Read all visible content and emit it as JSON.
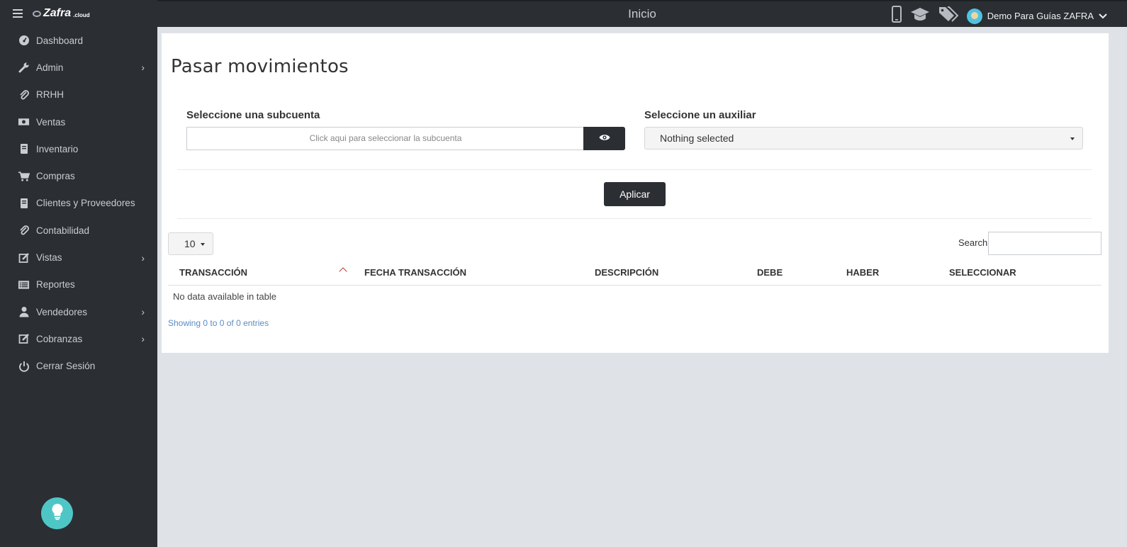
{
  "sidebar": {
    "brand": {
      "name": "Zafra",
      "suffix": ".cloud"
    },
    "items": [
      {
        "label": "Dashboard",
        "icon": "dashboard-icon",
        "has_children": false
      },
      {
        "label": "Admin",
        "icon": "wrench-icon",
        "has_children": true
      },
      {
        "label": "RRHH",
        "icon": "paperclip-icon",
        "has_children": false
      },
      {
        "label": "Ventas",
        "icon": "money-icon",
        "has_children": false
      },
      {
        "label": "Inventario",
        "icon": "book-icon",
        "has_children": false
      },
      {
        "label": "Compras",
        "icon": "cart-icon",
        "has_children": false
      },
      {
        "label": "Clientes y Proveedores",
        "icon": "book-icon",
        "has_children": false
      },
      {
        "label": "Contabilidad",
        "icon": "paperclip-icon",
        "has_children": false
      },
      {
        "label": "Vistas",
        "icon": "edit-icon",
        "has_children": true
      },
      {
        "label": "Reportes",
        "icon": "list-icon",
        "has_children": false
      },
      {
        "label": "Vendedores",
        "icon": "user-icon",
        "has_children": true
      },
      {
        "label": "Cobranzas",
        "icon": "edit-icon",
        "has_children": true
      },
      {
        "label": "Cerrar Sesión",
        "icon": "power-icon",
        "has_children": false
      }
    ],
    "help_icon": "lightbulb-icon"
  },
  "topbar": {
    "title": "Inicio",
    "user_name": "Demo Para Guías ZAFRA",
    "icons": [
      "mobile-icon",
      "graduation-cap-icon",
      "tags-icon"
    ]
  },
  "main": {
    "page_title": "Pasar movimientos",
    "subcuenta": {
      "label": "Seleccione una subcuenta",
      "placeholder": "Click aqui para seleccionar la subcuenta"
    },
    "auxiliar": {
      "label": "Seleccione un auxiliar",
      "selected": "Nothing selected"
    },
    "apply_label": "Aplicar",
    "table": {
      "page_length": "10",
      "search_label": "Search:",
      "search_value": "",
      "columns": [
        "TRANSACCIÓN",
        "FECHA TRANSACCIÓN",
        "DESCRIPCIÓN",
        "DEBE",
        "HABER",
        "SELECCIONAR"
      ],
      "sorted_column": "TRANSACCIÓN",
      "sort_direction": "asc",
      "empty_message": "No data available in table",
      "info": "Showing 0 to 0 of 0 entries"
    }
  },
  "colors": {
    "sidebar_bg": "#2b2e33",
    "content_bg": "#dfe3e8",
    "accent_teal": "#4fc6c6",
    "sort_red": "#c0392b",
    "info_blue": "#5b8cc2"
  }
}
